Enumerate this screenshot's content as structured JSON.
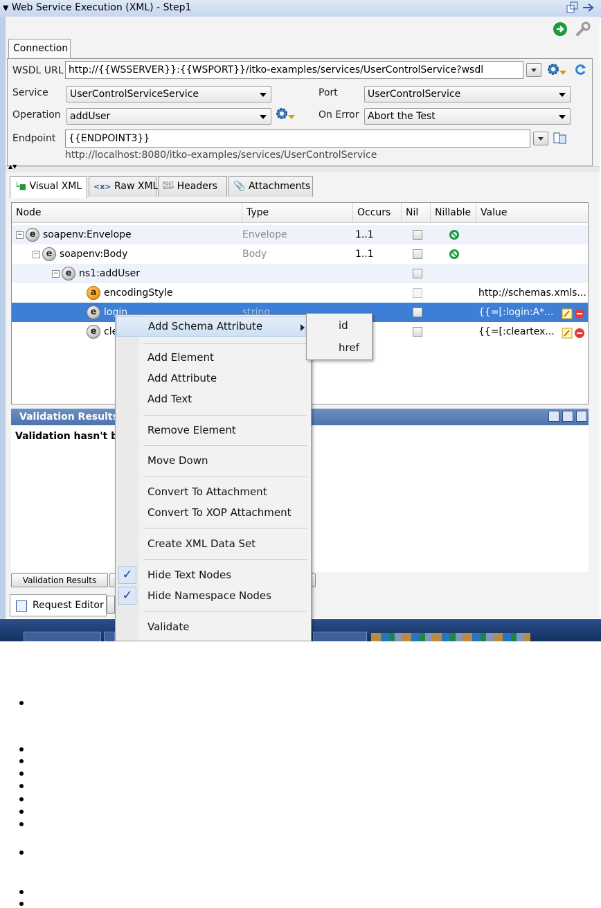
{
  "window": {
    "title": "Web Service Execution (XML) - Step1"
  },
  "connection": {
    "tab_label": "Connection",
    "wsdl_label": "WSDL URL",
    "wsdl_value": "http://{{WSSERVER}}:{{WSPORT}}/itko-examples/services/UserControlService?wsdl",
    "service_label": "Service",
    "service_value": "UserControlServiceService",
    "port_label": "Port",
    "port_value": "UserControlService",
    "operation_label": "Operation",
    "operation_value": "addUser",
    "onerror_label": "On Error",
    "onerror_value": "Abort the Test",
    "endpoint_label": "Endpoint",
    "endpoint_value": "{{ENDPOINT3}}",
    "endpoint_resolved": "http://localhost:8080/itko-examples/services/UserControlService"
  },
  "tabs": [
    "Visual XML",
    "Raw XML",
    "Headers",
    "Attachments"
  ],
  "tab_icon_post": "POST",
  "tab_icon_soap": "SOAP",
  "tree": {
    "columns": [
      "Node",
      "Type",
      "Occurs",
      "Nil",
      "Nillable",
      "Value"
    ],
    "rows": [
      {
        "name": "soapenv:Envelope",
        "type": "Envelope",
        "occurs": "1..1",
        "value": ""
      },
      {
        "name": "soapenv:Body",
        "type": "Body",
        "occurs": "1..1",
        "value": ""
      },
      {
        "name": "ns1:addUser",
        "type": "",
        "occurs": "",
        "value": ""
      },
      {
        "name": "encodingStyle",
        "type": "",
        "occurs": "",
        "value": "http://schemas.xmls..."
      },
      {
        "name": "login",
        "type": "string",
        "occurs": "",
        "value": "{{=[:login:A*..."
      },
      {
        "name": "cle",
        "type": "",
        "occurs": "",
        "value": "{{=[:cleartex..."
      }
    ]
  },
  "validation": {
    "header": "Validation Results",
    "message": "Validation hasn't b",
    "button": "Validation Results"
  },
  "bottom_tab": "Request Editor",
  "context_menu": {
    "items": [
      "Add Schema Attribute",
      "Add Element",
      "Add Attribute",
      "Add Text",
      "Remove Element",
      "Move Down",
      "Convert To Attachment",
      "Convert To XOP Attachment",
      "Create XML Data Set",
      "Hide Text Nodes",
      "Hide Namespace Nodes",
      "Validate"
    ],
    "submenu": [
      "id",
      "href"
    ]
  },
  "colors": {
    "selection": "#3d7fd6",
    "header_blue": "#4e74ad",
    "accent_green": "#1c9a3c"
  }
}
